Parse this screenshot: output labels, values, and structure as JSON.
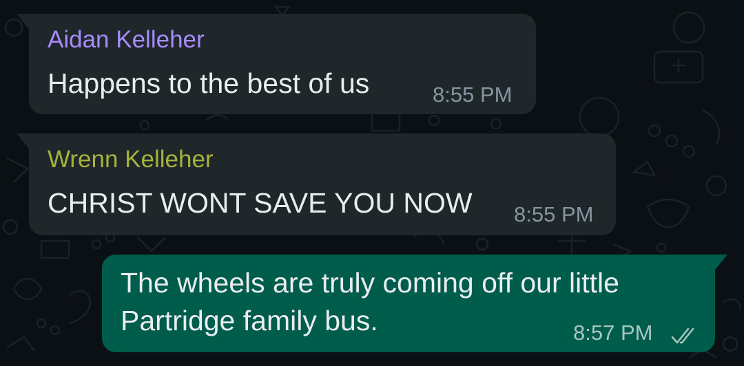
{
  "colors": {
    "background": "#0b1014",
    "incoming_bubble": "#1f272a",
    "outgoing_bubble": "#005c4b",
    "message_text": "#e9edef",
    "timestamp": "#8696a0",
    "sender_1": "#a78bfa",
    "sender_2": "#a6b23a"
  },
  "messages": [
    {
      "direction": "incoming",
      "sender": "Aidan Kelleher",
      "sender_color": "#a78bfa",
      "text": "Happens to the best of us",
      "time": "8:55 PM"
    },
    {
      "direction": "incoming",
      "sender": "Wrenn Kelleher",
      "sender_color": "#a6b23a",
      "text": "CHRIST WONT SAVE YOU NOW",
      "time": "8:55 PM"
    },
    {
      "direction": "outgoing",
      "text_line1": "The wheels are truly coming off our little",
      "text_line2": "Partridge family bus.",
      "time": "8:57 PM",
      "status_icon": "double-check-icon"
    }
  ]
}
